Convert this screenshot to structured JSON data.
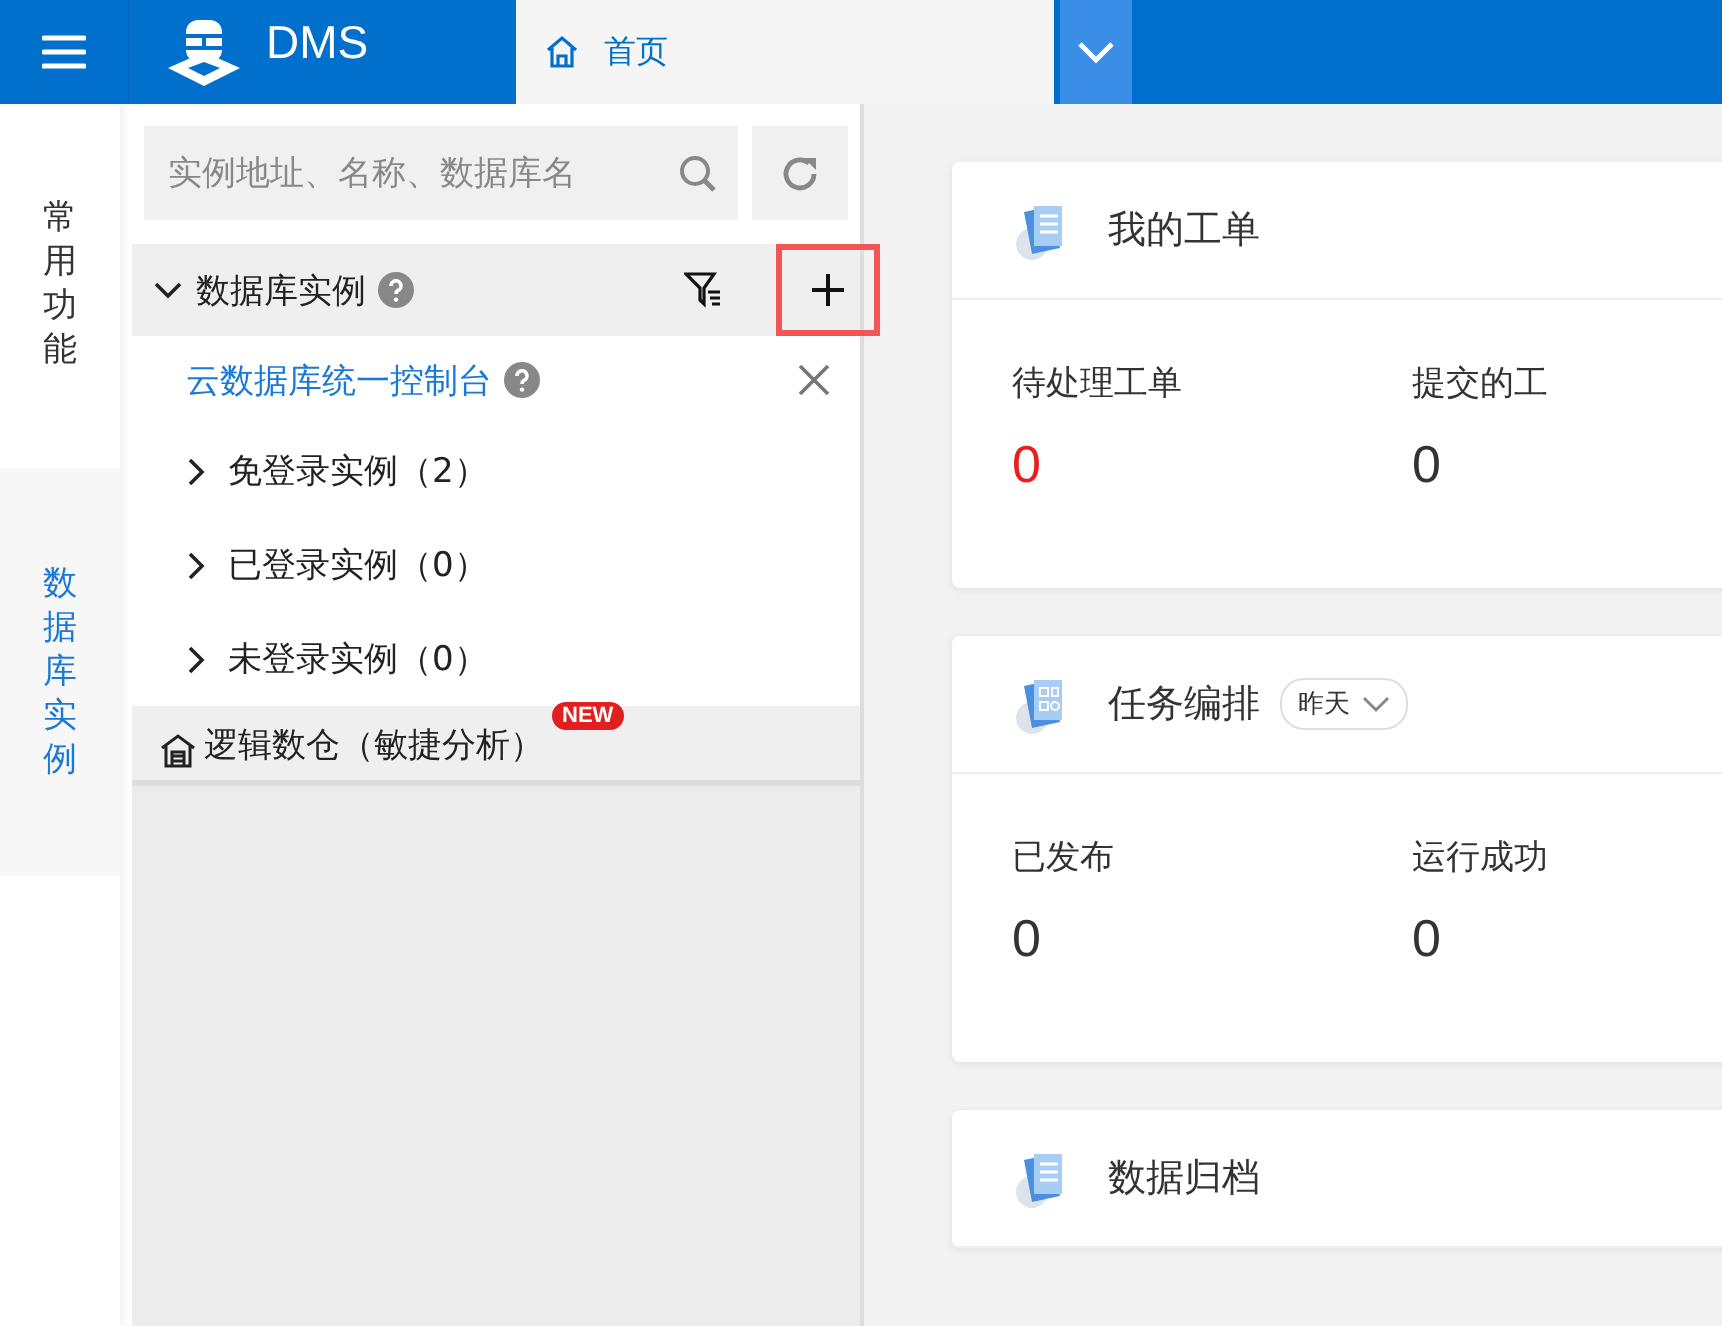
{
  "header": {
    "logo": "DMS",
    "tabs": [
      {
        "label": "首页",
        "selected": true
      }
    ]
  },
  "nav": [
    {
      "label": "常用功能",
      "selected": false
    },
    {
      "label": "数据库实例",
      "selected": true
    }
  ],
  "panel": {
    "search": {
      "placeholder": "实例地址、名称、数据库名"
    },
    "section": {
      "label": "数据库实例",
      "expanded": true,
      "link": "云数据库统一控制台",
      "children": [
        {
          "label": "免登录实例（2）",
          "expanded": false
        },
        {
          "label": "已登录实例（0）",
          "expanded": false
        },
        {
          "label": "未登录实例（0）",
          "expanded": false
        }
      ]
    },
    "warehouse": {
      "label": "逻辑数仓（敏捷分析）",
      "badge": "NEW"
    }
  },
  "cards": [
    {
      "title": "我的工单",
      "stats": [
        {
          "label": "待处理工单",
          "value": "0",
          "alert": true
        },
        {
          "label": "提交的工",
          "value": "0",
          "alert": false
        }
      ]
    },
    {
      "title": "任务编排",
      "filter": "昨天",
      "stats": [
        {
          "label": "已发布",
          "value": "0",
          "alert": false
        },
        {
          "label": "运行成功",
          "value": "0",
          "alert": false
        }
      ]
    },
    {
      "title": "数据归档"
    }
  ]
}
